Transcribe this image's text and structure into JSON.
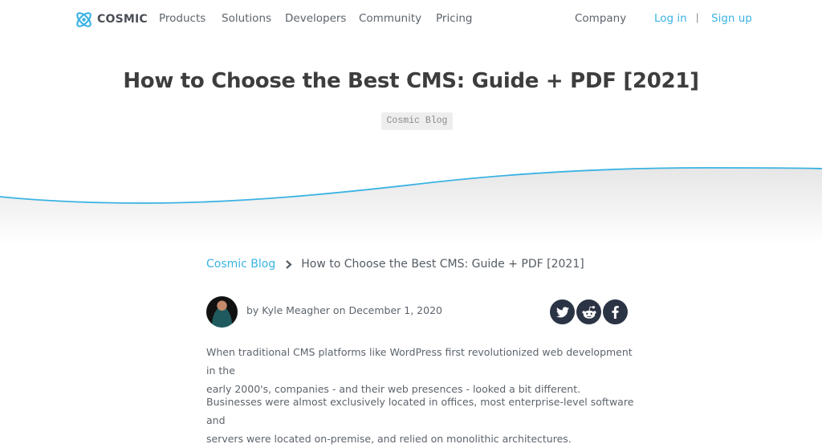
{
  "brand": {
    "name": "COSMIC",
    "logo_icon": "atom-logo-icon",
    "accent_color": "#3ab3e3"
  },
  "nav": {
    "items": [
      {
        "label": "Products"
      },
      {
        "label": "Solutions"
      },
      {
        "label": "Developers"
      },
      {
        "label": "Community"
      },
      {
        "label": "Pricing"
      }
    ],
    "company": "Company",
    "login": "Log in",
    "separator": "|",
    "signup": "Sign up"
  },
  "hero": {
    "title": "How to Choose the Best CMS: Guide + PDF [2021]",
    "tag": "Cosmic Blog"
  },
  "breadcrumb": {
    "parent": "Cosmic Blog",
    "separator_icon": "chevron-right-icon",
    "current": "How to Choose the Best CMS: Guide + PDF [2021]"
  },
  "author": {
    "byline": "by Kyle Meagher on December 1, 2020"
  },
  "share": {
    "icons": [
      "twitter-icon",
      "reddit-icon",
      "facebook-icon"
    ],
    "color": "#2b3445"
  },
  "article": {
    "paragraphs": [
      {
        "line1": "When traditional CMS platforms like WordPress first revolutionized web development in the",
        "line2": "early 2000's, companies - and their web presences - looked a bit different."
      },
      {
        "line1": "Businesses were almost exclusively located in offices, most enterprise-level software and",
        "line2": "servers were located on-premise, and relied on monolithic architectures."
      }
    ]
  }
}
